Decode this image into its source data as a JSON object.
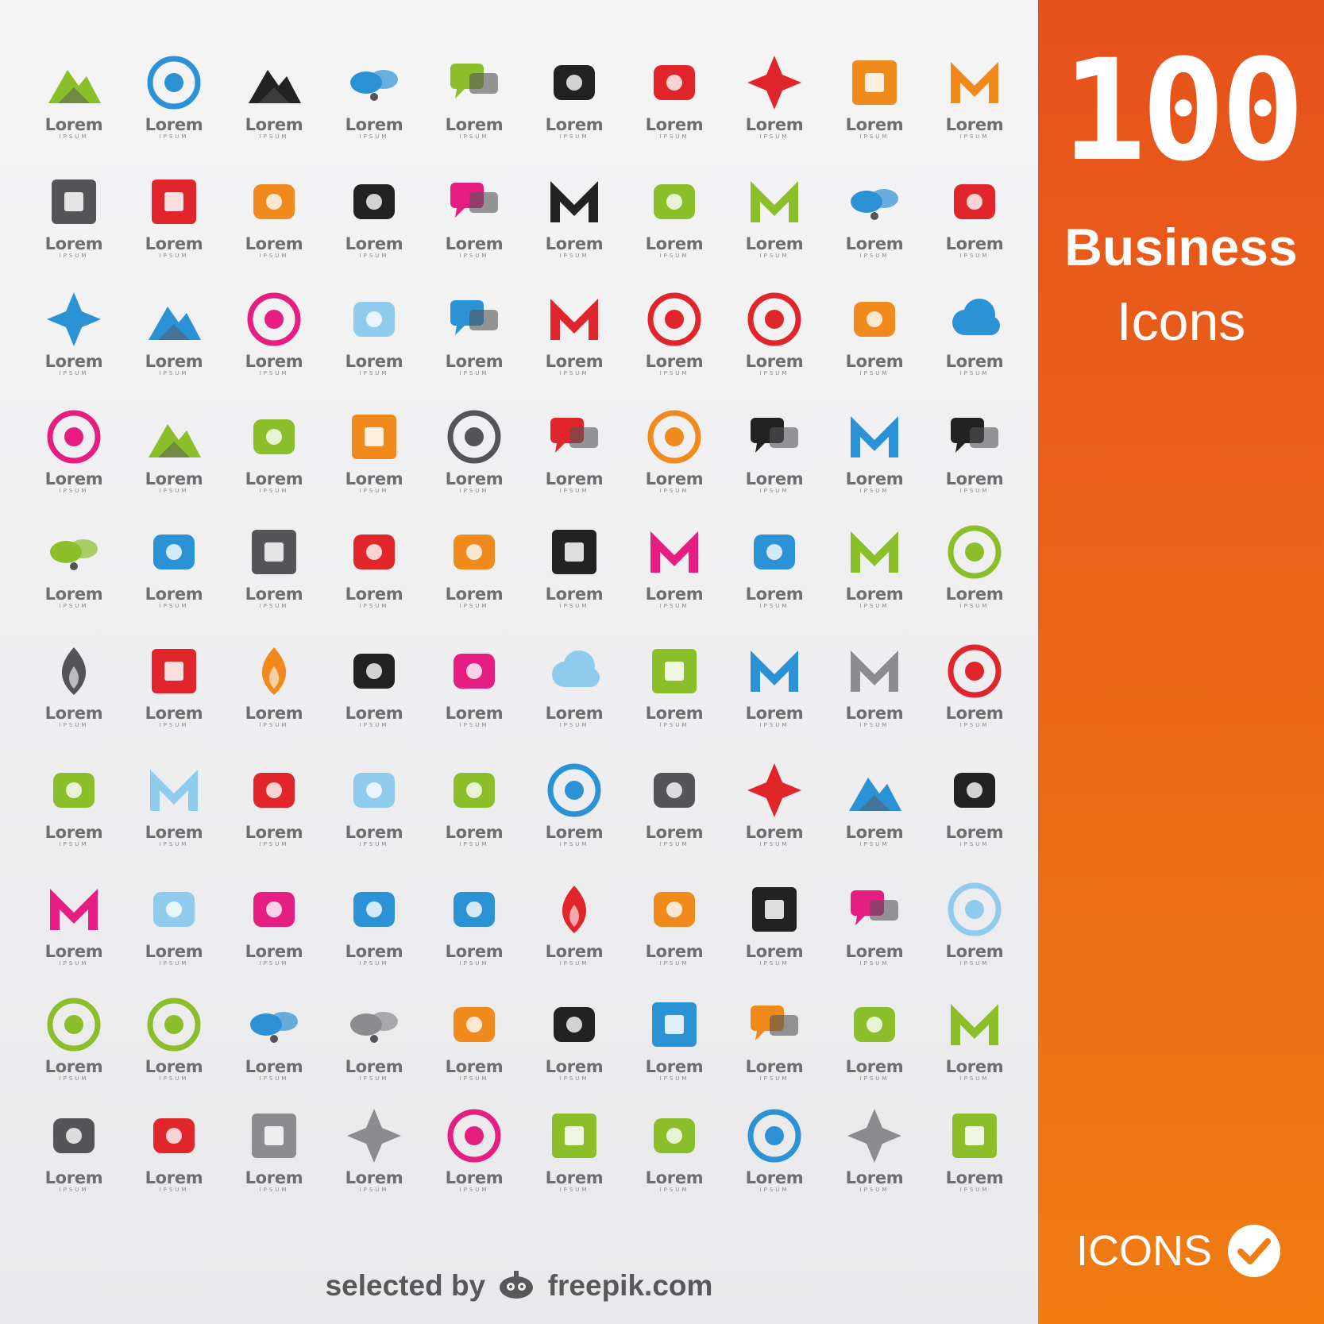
{
  "sidebar": {
    "number": "100",
    "title_line1": "Business",
    "title_line2": "Icons",
    "icons_label": "ICONS",
    "bg_top": "#e6511c",
    "bg_bottom": "#f07c12"
  },
  "footer": {
    "prefix": "selected by",
    "brand": "freepik.com"
  },
  "logo_word": "Lorem",
  "logo_sub": "IPSUM",
  "icons": [
    [
      "mountain-leaf-icon",
      "circle-mountain-icon",
      "dark-mountain-icon",
      "blue-fish-icon",
      "green-e-bubble-icon",
      "fork-bowtie-icon",
      "red-flag-icon",
      "red-ball-star-icon",
      "orange-boxes-icon",
      "orange-m-icon"
    ],
    [
      "color-blocks-icon",
      "square-frame-icon",
      "color-rays-icon",
      "coffee-cup-icon",
      "speech-bubbles-icon",
      "black-z-icon",
      "squiggle-line-icon",
      "green-m-icon",
      "blue-butterfly-icon",
      "moose-head-icon"
    ],
    [
      "blue-diamond-window-icon",
      "blue-mountain-grid-icon",
      "ship-circle-icon",
      "dotted-fan-icon",
      "blue-chat-bubbles-icon",
      "red-v-icon",
      "red-me-circle-icon",
      "moon-circle-icon",
      "flask-icon",
      "blue-cloud-icon"
    ],
    [
      "m-circle-icon",
      "green-mountains-sun-icon",
      "spy-magnifier-icon",
      "orange-printer-icon",
      "number-four-circle-icon",
      "play-bubble-icon",
      "my-circle-icon",
      "bubbles-tube-icon",
      "blue-arrows-icon",
      "dark-speech-icon"
    ],
    [
      "wings-icon",
      "weathervane-rooster-icon",
      "play-square-icon",
      "leo-sign-icon",
      "envelope-icon",
      "linked-squares-icon",
      "refresh-arrows-icon",
      "blue-wave-icon",
      "money-arrow-icon",
      "green-arrow-circle-icon"
    ],
    [
      "flame-icon",
      "flame-square-icon",
      "lotus-icon",
      "airplane-icon",
      "line-graph-icon",
      "cloud-sync-icon",
      "picture-frame-icon",
      "n-letter-icon",
      "gray-arrow-icon",
      "sigma-circle-icon"
    ],
    [
      "green-scribble-icon",
      "light-blue-v-icon",
      "red-mobile-icon",
      "castle-tower-icon",
      "dancers-icon",
      "blue-ring-icon",
      "smoke-tube-icon",
      "color-star-icon",
      "blue-mountain-square-icon",
      "compass-a-icon"
    ],
    [
      "um-letters-icon",
      "house-outline-icon",
      "pink-heart-icon",
      "family-icon",
      "blue-bottle-icon",
      "flower-pipe-icon",
      "fruit-bowl-icon",
      "corner-squares-icon",
      "bubbles-face-icon",
      "mountain-circle-icon"
    ],
    [
      "triangle-circle-icon",
      "green-swirl-icon",
      "blue-bird-icon",
      "gray-bird-icon",
      "open-book-icon",
      "angle-brackets-icon",
      "blue-puzzle-icon",
      "orange-chat-icon",
      "green-smile-icon",
      "green-c-icon"
    ],
    [
      "chef-hat-icon",
      "g-ladybug-icon",
      "gray-diamond-frame-icon",
      "light-diamond-icon",
      "gold-ring-icon",
      "green-g-square-icon",
      "green-sunrise-icon",
      "blue-swirl-icon",
      "gray-cross-icon",
      "green-black-square-icon"
    ]
  ],
  "colors": {
    "gray_dark": "#555559",
    "gray": "#8c8c90",
    "green": "#8bbf2a",
    "blue": "#2c92d6",
    "red": "#e0262b",
    "orange": "#f08a1d",
    "black": "#222222",
    "pink": "#e61e82",
    "light_blue": "#8fcbed"
  }
}
